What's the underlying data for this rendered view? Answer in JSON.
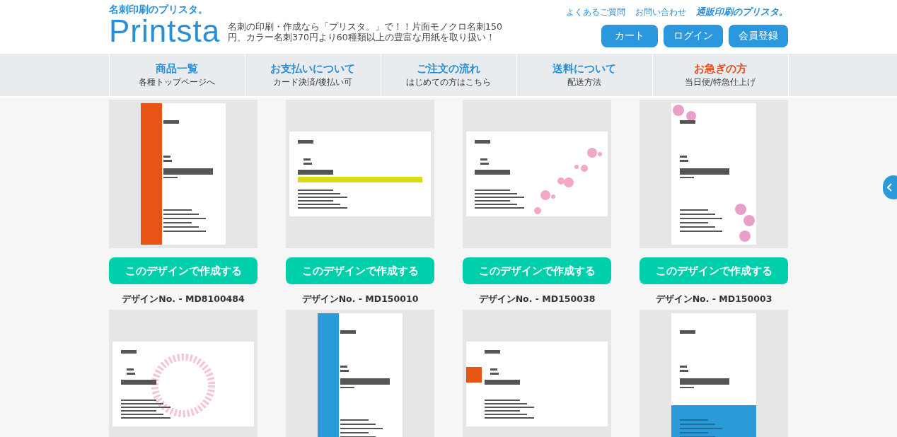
{
  "header": {
    "tagline_small": "名刺印刷のプリスタ。",
    "logo": "Printsta",
    "description": "名刺の印刷・作成なら「プリスタ。」で！！片面モノクロ名刺150円、カラー名刺370円より60種類以上の豊富な用紙を取り扱い！",
    "links": [
      "よくあるご質問",
      "お問い合わせ"
    ],
    "sister_site": "通販印刷のプリスタ。",
    "buttons": [
      "カート",
      "ログイン",
      "会員登録"
    ]
  },
  "nav": [
    {
      "title": "商品一覧",
      "subtitle": "各種トップページへ",
      "highlighted": false
    },
    {
      "title": "お支払いについて",
      "subtitle": "カード決済/後払い可",
      "highlighted": false
    },
    {
      "title": "ご注文の流れ",
      "subtitle": "はじめての方はこちら",
      "highlighted": false
    },
    {
      "title": "送料について",
      "subtitle": "配送方法",
      "highlighted": false
    },
    {
      "title": "お急ぎの方",
      "subtitle": "当日便/特急仕上げ",
      "highlighted": true
    }
  ],
  "designs": [
    {
      "kind": "left-bar",
      "color": "#e85414",
      "button": "このデザインで作成する",
      "number": "デザインNo. - MD8100484"
    },
    {
      "kind": "stripe",
      "color": "#d8dc10",
      "button": "このデザインで作成する",
      "number": "デザインNo. - MD150010"
    },
    {
      "kind": "sakura",
      "color": "#f4a8c8",
      "button": "このデザインで作成する",
      "number": "デザインNo. - MD150038"
    },
    {
      "kind": "dots",
      "color": "#e8a0c8",
      "button": "このデザインで作成する",
      "number": "デザインNo. - MD150003"
    },
    {
      "kind": "lace",
      "color": "#f6c4d4"
    },
    {
      "kind": "left-bar",
      "color": "#2a9ad8"
    },
    {
      "kind": "square",
      "color": "#e85414"
    },
    {
      "kind": "bottom-band",
      "color": "#2a9ad8"
    }
  ]
}
